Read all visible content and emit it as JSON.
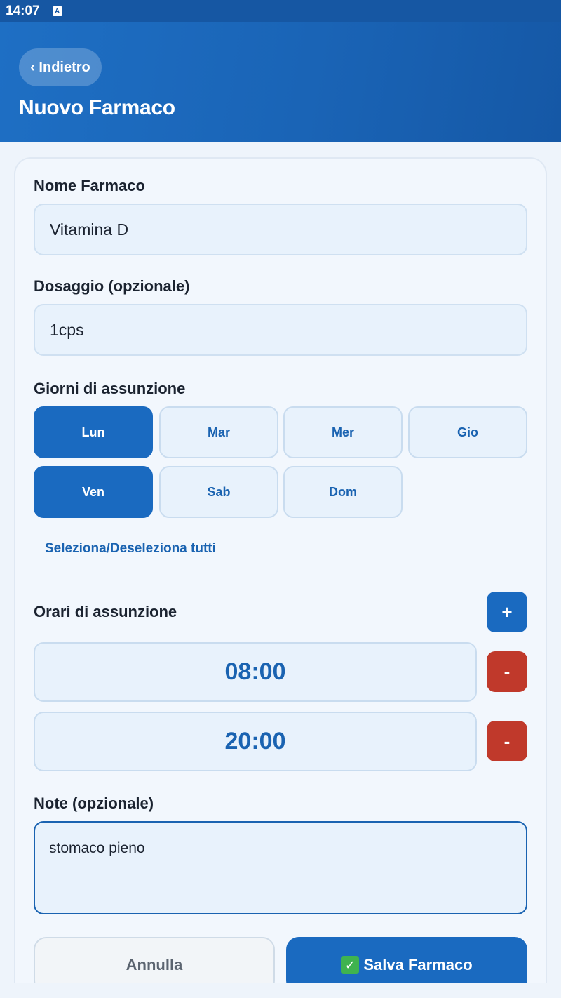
{
  "status_bar": {
    "time": "14:07",
    "indicator": "A"
  },
  "header": {
    "back_label": "‹ Indietro",
    "title": "Nuovo Farmaco"
  },
  "form": {
    "name_label": "Nome Farmaco",
    "name_value": "Vitamina D",
    "dosage_label": "Dosaggio (opzionale)",
    "dosage_value": "1cps",
    "days_label": "Giorni di assunzione",
    "days": [
      {
        "label": "Lun",
        "selected": true
      },
      {
        "label": "Mar",
        "selected": false
      },
      {
        "label": "Mer",
        "selected": false
      },
      {
        "label": "Gio",
        "selected": false
      },
      {
        "label": "Ven",
        "selected": true
      },
      {
        "label": "Sab",
        "selected": false
      },
      {
        "label": "Dom",
        "selected": false
      }
    ],
    "toggle_all_label": "Seleziona/Deseleziona tutti",
    "times_label": "Orari di assunzione",
    "add_time_symbol": "+",
    "remove_time_symbol": "-",
    "times": [
      "08:00",
      "20:00"
    ],
    "notes_label": "Note (opzionale)",
    "notes_value": "stomaco pieno",
    "cancel_label": "Annulla",
    "save_label": "Salva Farmaco"
  },
  "colors": {
    "primary": "#1a6ac0",
    "danger": "#c0392b",
    "header_bg": "#1a64b6",
    "page_bg": "#eef4fb"
  }
}
